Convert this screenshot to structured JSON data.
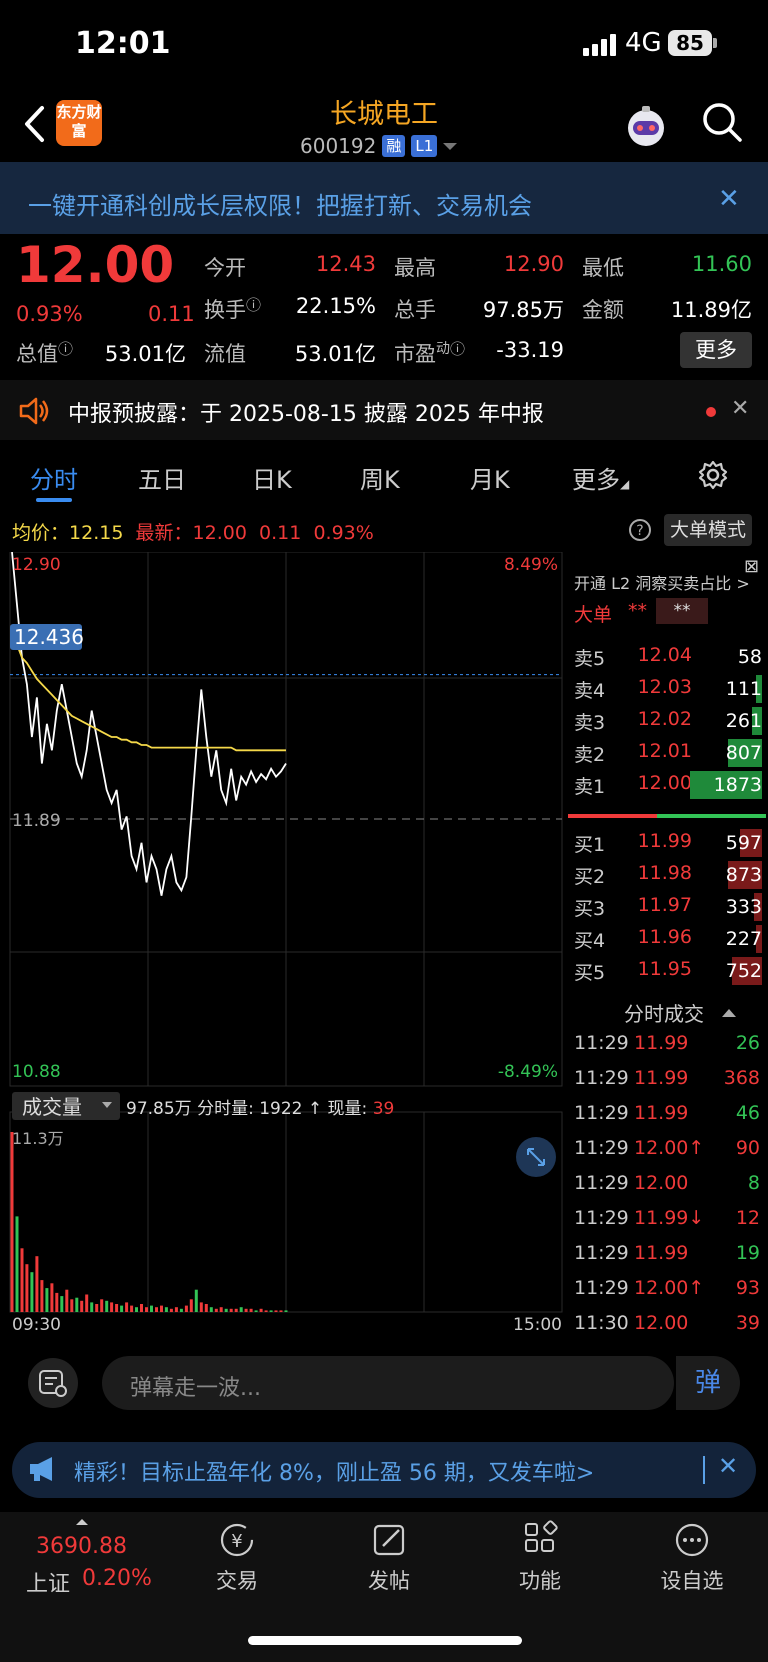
{
  "status_bar": {
    "time": "12:01",
    "network": "4G",
    "battery": "85"
  },
  "header": {
    "logo_text": "东方财富",
    "title": "长城电工",
    "code": "600192",
    "tag1": "融",
    "tag2": "L1"
  },
  "banner": {
    "text": "一键开通科创成长层权限！把握打新、交易机会",
    "close": "✕"
  },
  "quote": {
    "price": "12.00",
    "change_pct": "0.93%",
    "change": "0.11",
    "open_label": "今开",
    "open": "12.43",
    "high_label": "最高",
    "high": "12.90",
    "low_label": "最低",
    "low": "11.60",
    "turnover_label": "换手",
    "turnover": "22.15%",
    "volume_label": "总手",
    "volume": "97.85万",
    "amount_label": "金额",
    "amount": "11.89亿",
    "mktcap_label": "总值",
    "mktcap": "53.01亿",
    "float_label": "流值",
    "float": "53.01亿",
    "pe_label": "市盈",
    "pe_sup": "动",
    "pe": "-33.19",
    "more": "更多"
  },
  "notice": {
    "text": "中报预披露：于 2025-08-15 披露 2025 年中报",
    "close": "✕"
  },
  "tabs": [
    "分时",
    "五日",
    "日K",
    "周K",
    "月K",
    "更多"
  ],
  "chart_header": {
    "avg_label": "均价：",
    "avg": "12.15",
    "last_label": "最新：",
    "last": "12.00",
    "last_chg": "0.11",
    "last_pct": "0.93%",
    "mode_button": "大单模式"
  },
  "chart_data": {
    "type": "line",
    "y_top": "12.90",
    "y_bottom": "10.88",
    "y_mid": "11.89",
    "pct_top": "8.49%",
    "pct_bottom": "-8.49%",
    "ref_line": "12.436",
    "ylim": [
      10.88,
      12.9
    ],
    "prev_close": 11.89,
    "x_start": "09:30",
    "x_end": "15:00",
    "volume_label": "成交量",
    "volume_total": "97.85万",
    "minute_vol_label": "分时量:",
    "minute_vol": "1922 ↑",
    "cur_vol_label": "现量:",
    "cur_vol": "39",
    "vol_max": "11.3万",
    "series": [
      {
        "values": [
          12.9,
          12.7,
          12.5,
          12.4,
          12.2,
          12.35,
          12.1,
          12.25,
          12.15,
          12.3,
          12.4,
          12.3,
          12.2,
          12.1,
          12.05,
          12.15,
          12.3,
          12.2,
          12.1,
          12.0,
          11.95,
          12.0,
          11.85,
          11.9,
          11.75,
          11.7,
          11.8,
          11.65,
          11.75,
          11.7,
          11.6,
          11.7,
          11.75,
          11.65,
          11.62,
          11.67,
          11.9,
          12.15,
          12.38,
          12.2,
          12.05,
          12.15,
          12.0,
          11.95,
          12.08,
          11.96,
          12.05,
          12.02,
          12.07,
          12.03,
          12.06,
          12.04,
          12.08,
          12.05,
          12.07,
          12.1
        ]
      },
      {
        "values": [
          12.6,
          12.55,
          12.5,
          12.48,
          12.45,
          12.42,
          12.4,
          12.38,
          12.36,
          12.34,
          12.32,
          12.3,
          12.28,
          12.27,
          12.26,
          12.25,
          12.24,
          12.23,
          12.22,
          12.21,
          12.2,
          12.2,
          12.19,
          12.19,
          12.18,
          12.18,
          12.17,
          12.17,
          12.16,
          12.16,
          12.16,
          12.16,
          12.16,
          12.16,
          12.16,
          12.16,
          12.16,
          12.16,
          12.16,
          12.16,
          12.16,
          12.16,
          12.16,
          12.16,
          12.16,
          12.15,
          12.15,
          12.15,
          12.15,
          12.15,
          12.15,
          12.15,
          12.15,
          12.15,
          12.15,
          12.15
        ]
      }
    ],
    "volume": [
      113000,
      60000,
      40000,
      30000,
      25000,
      35000,
      20000,
      15000,
      18000,
      12000,
      10000,
      14000,
      8000,
      9000,
      7000,
      11000,
      6000,
      5000,
      8000,
      7000,
      6000,
      5000,
      4000,
      6000,
      4000,
      3000,
      5000,
      3000,
      4000,
      3000,
      4000,
      3000,
      2000,
      3000,
      2000,
      4000,
      8000,
      14000,
      6000,
      5000,
      3000,
      2000,
      3000,
      2000,
      2000,
      2000,
      3000,
      2000,
      2000,
      1000,
      2000,
      1000,
      1000,
      1000,
      1000,
      1000
    ]
  },
  "panel": {
    "l2_header": "开通 L2 洞察买卖占比 >",
    "big_label": "大单",
    "big_stars1": "**",
    "big_stars2": "**",
    "asks": [
      {
        "label": "卖5",
        "price": "12.04",
        "vol": "58"
      },
      {
        "label": "卖4",
        "price": "12.03",
        "vol": "111"
      },
      {
        "label": "卖3",
        "price": "12.02",
        "vol": "261"
      },
      {
        "label": "卖2",
        "price": "12.01",
        "vol": "807"
      },
      {
        "label": "卖1",
        "price": "12.00",
        "vol": "1873"
      }
    ],
    "bids": [
      {
        "label": "买1",
        "price": "11.99",
        "vol": "597"
      },
      {
        "label": "买2",
        "price": "11.98",
        "vol": "873"
      },
      {
        "label": "买3",
        "price": "11.97",
        "vol": "333"
      },
      {
        "label": "买4",
        "price": "11.96",
        "vol": "227"
      },
      {
        "label": "买5",
        "price": "11.95",
        "vol": "752"
      }
    ],
    "tick_title": "分时成交",
    "ticks": [
      {
        "time": "11:29",
        "price": "11.99",
        "vol": "26"
      },
      {
        "time": "11:29",
        "price": "11.99",
        "vol": "368"
      },
      {
        "time": "11:29",
        "price": "11.99",
        "vol": "46"
      },
      {
        "time": "11:29",
        "price": "12.00↑",
        "vol": "90"
      },
      {
        "time": "11:29",
        "price": "12.00",
        "vol": "8"
      },
      {
        "time": "11:29",
        "price": "11.99↓",
        "vol": "12"
      },
      {
        "time": "11:29",
        "price": "11.99",
        "vol": "19"
      },
      {
        "time": "11:29",
        "price": "12.00↑",
        "vol": "93"
      },
      {
        "time": "11:30",
        "price": "12.00",
        "vol": "39"
      }
    ]
  },
  "danmu": {
    "placeholder": "弹幕走一波...",
    "send": "弹"
  },
  "promo": {
    "text": "精彩！目标止盈年化 8%，刚止盈 56 期，又发车啦>",
    "close": "✕"
  },
  "bottom_nav": {
    "index_value": "3690.88",
    "index_name": "上证",
    "index_pct": "0.20%",
    "items": [
      "交易",
      "发帖",
      "功能",
      "设自选"
    ]
  },
  "colors": {
    "up": "#f03a3a",
    "down": "#33c456",
    "accent": "#3a8cf0",
    "avg_line": "#f5d94a"
  }
}
